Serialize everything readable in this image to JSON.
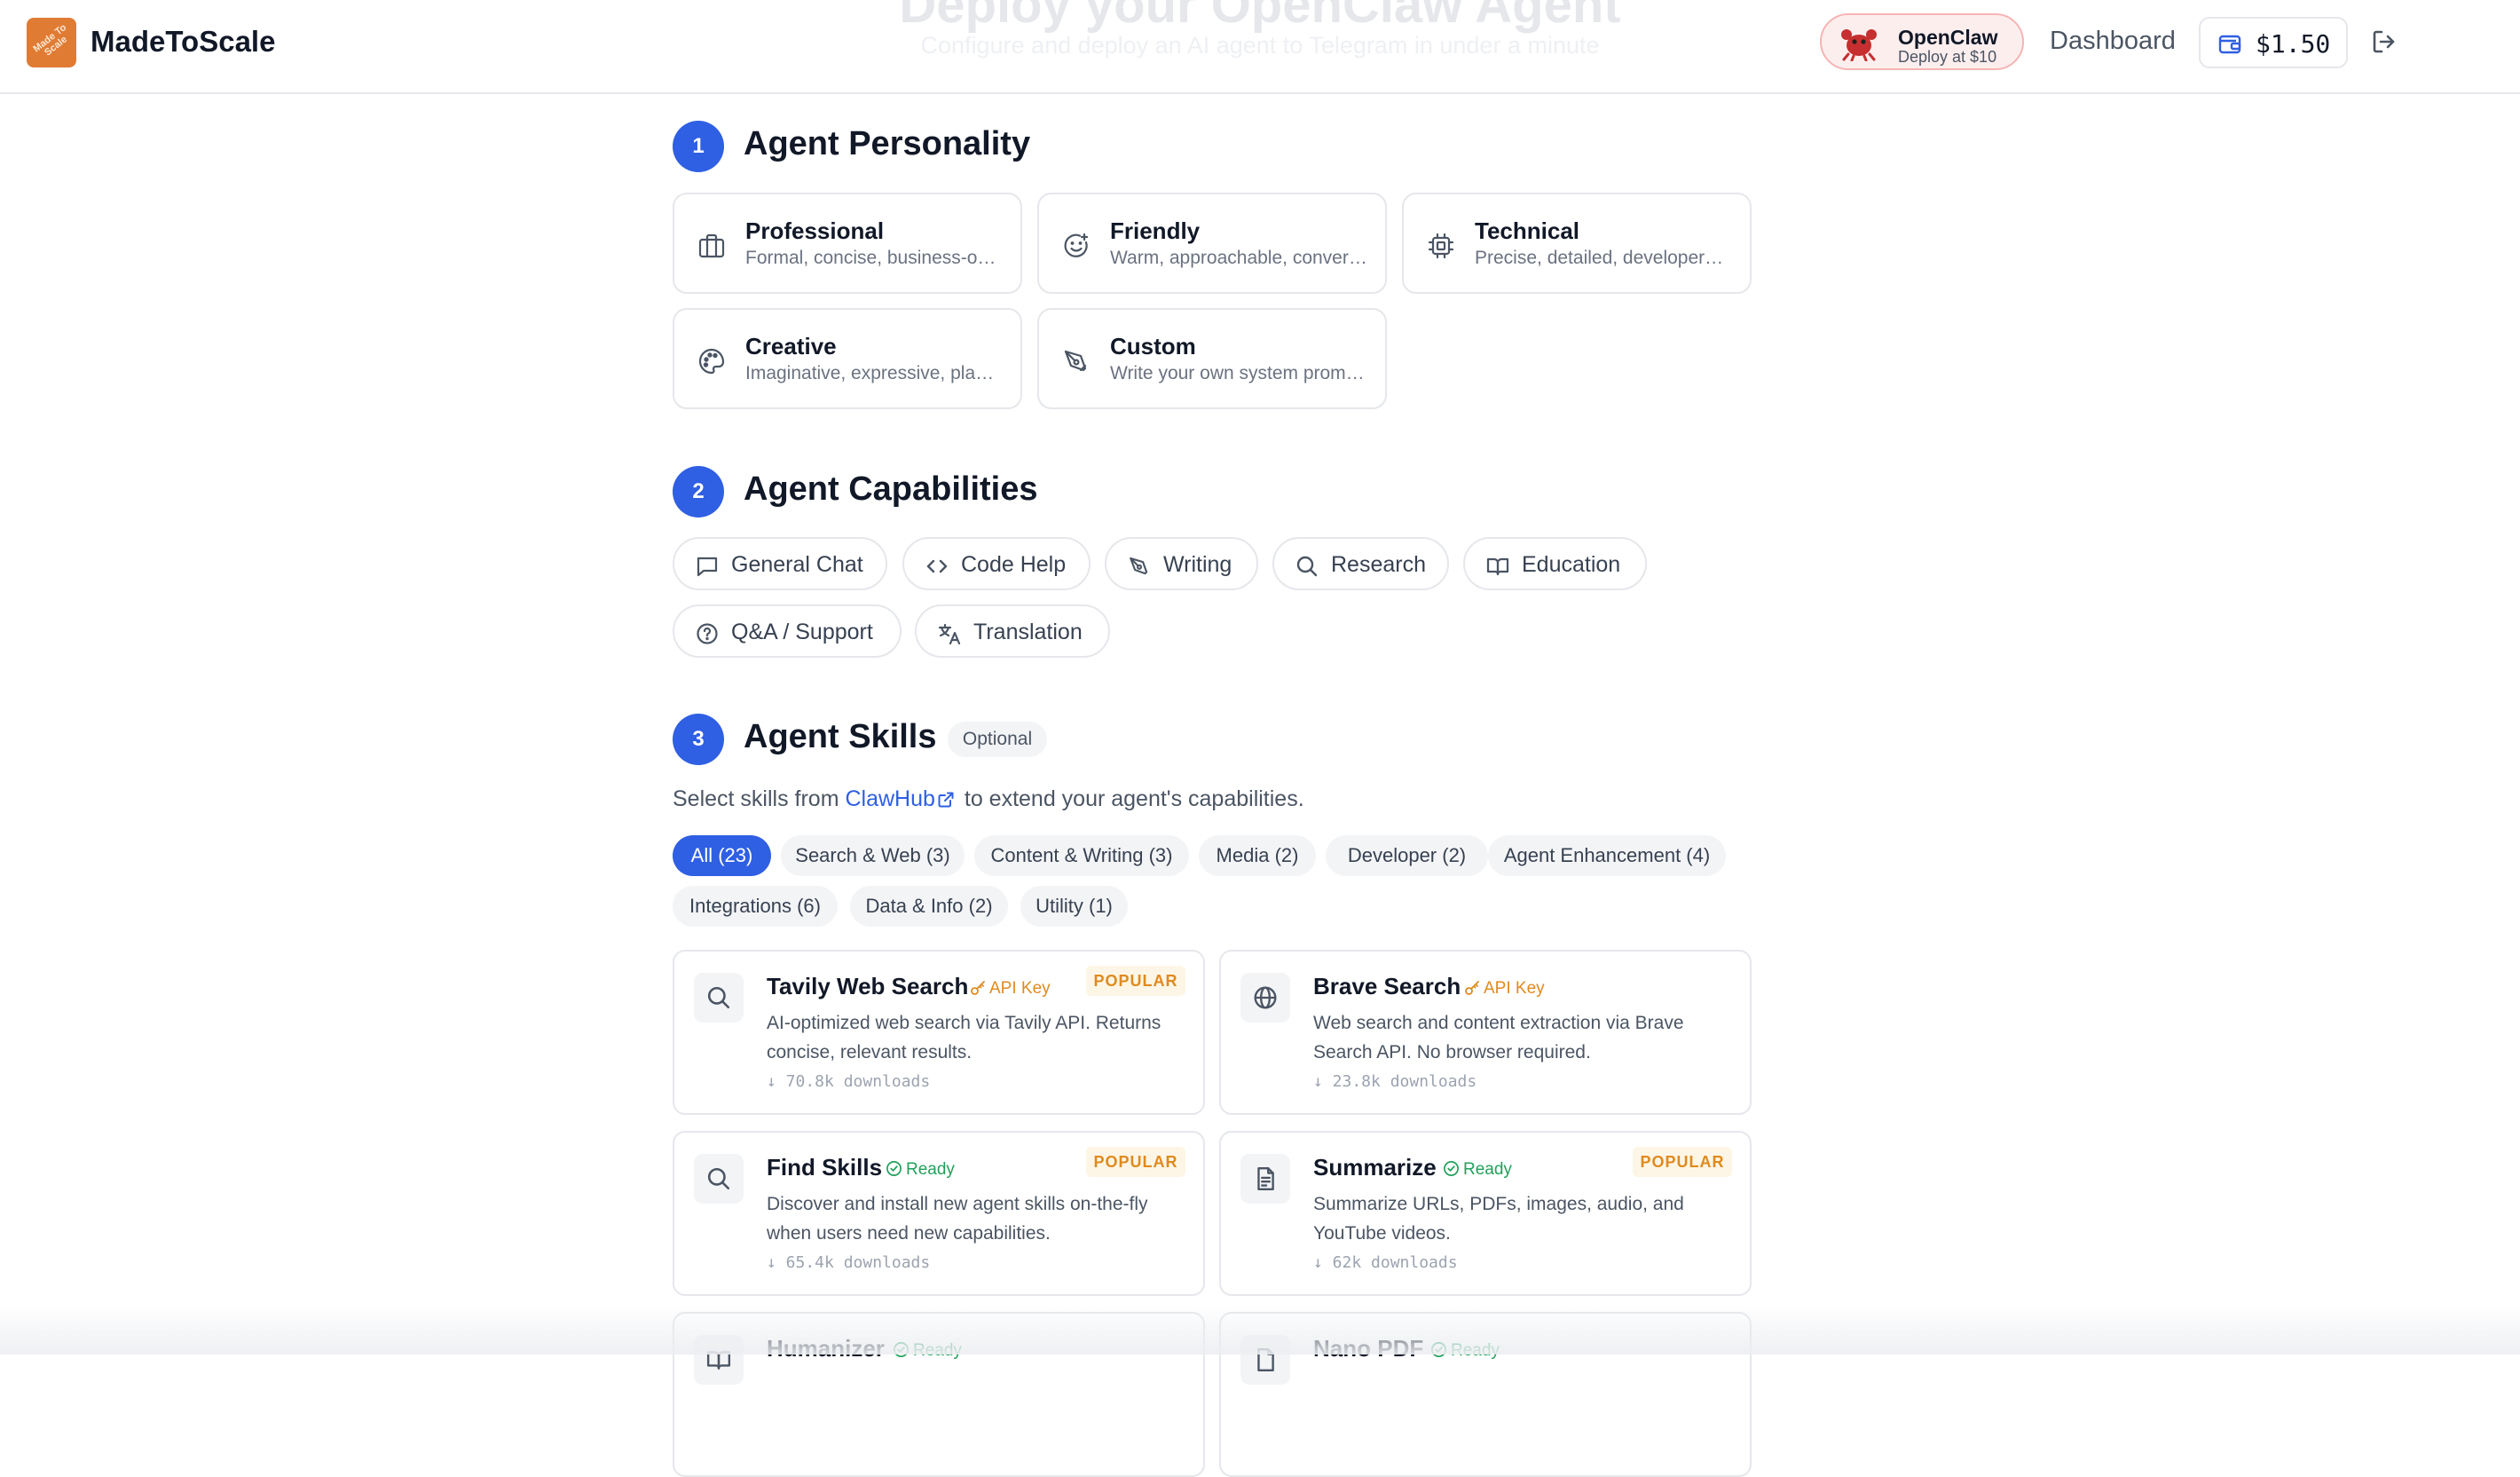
{
  "header": {
    "ghost_title": "Deploy your OpenClaw Agent",
    "ghost_subtitle": "Configure and deploy an AI agent to Telegram in under a minute",
    "brand": "MadeToScale",
    "logo_text": "Made To Scale",
    "openclaw_title": "OpenClaw",
    "openclaw_sub": "Deploy at $10",
    "dashboard": "Dashboard",
    "balance": "$1.50"
  },
  "personality": {
    "number": "1",
    "title": "Agent Personality",
    "cards": [
      {
        "title": "Professional",
        "desc": "Formal, concise, business-o…",
        "icon": "briefcase-icon"
      },
      {
        "title": "Friendly",
        "desc": "Warm, approachable, conver…",
        "icon": "smile-icon"
      },
      {
        "title": "Technical",
        "desc": "Precise, detailed, developer…",
        "icon": "cpu-icon"
      },
      {
        "title": "Creative",
        "desc": "Imaginative, expressive, pla…",
        "icon": "palette-icon"
      },
      {
        "title": "Custom",
        "desc": "Write your own system prom…",
        "icon": "pen-tool-icon"
      }
    ]
  },
  "capabilities": {
    "number": "2",
    "title": "Agent Capabilities",
    "items": [
      {
        "label": "General Chat",
        "icon": "message-square-icon"
      },
      {
        "label": "Code Help",
        "icon": "code-icon"
      },
      {
        "label": "Writing",
        "icon": "pen-tool-icon"
      },
      {
        "label": "Research",
        "icon": "search-icon"
      },
      {
        "label": "Education",
        "icon": "book-open-icon"
      },
      {
        "label": "Q&A / Support",
        "icon": "help-circle-icon"
      },
      {
        "label": "Translation",
        "icon": "languages-icon"
      }
    ]
  },
  "skills": {
    "number": "3",
    "title": "Agent Skills",
    "optional": "Optional",
    "intro_before": "Select skills from ",
    "intro_link": "ClawHub",
    "intro_after": " to extend your agent's capabilities.",
    "filters": [
      "All (23)",
      "Search & Web (3)",
      "Content & Writing (3)",
      "Media (2)",
      "Developer (2)",
      "Agent Enhancement (4)",
      "Integrations (6)",
      "Data & Info (2)",
      "Utility (1)"
    ],
    "active_filter": 0,
    "cards": [
      {
        "name": "Tavily Web Search",
        "status": "API Key",
        "popular": "POPULAR",
        "desc": "AI-optimized web search via Tavily API. Returns concise, relevant results.",
        "downloads": "↓ 70.8k downloads",
        "icon": "search-icon"
      },
      {
        "name": "Brave Search",
        "status": "API Key",
        "popular": "",
        "desc": "Web search and content extraction via Brave Search API. No browser required.",
        "downloads": "↓ 23.8k downloads",
        "icon": "globe-icon"
      },
      {
        "name": "Find Skills",
        "status": "Ready",
        "popular": "POPULAR",
        "desc": "Discover and install new agent skills on-the-fly when users need new capabilities.",
        "downloads": "↓ 65.4k downloads",
        "icon": "search-icon"
      },
      {
        "name": "Summarize",
        "status": "Ready",
        "popular": "POPULAR",
        "desc": "Summarize URLs, PDFs, images, audio, and YouTube videos.",
        "downloads": "↓ 62k downloads",
        "icon": "file-text-icon"
      },
      {
        "name": "Humanizer",
        "status": "Ready",
        "popular": "",
        "desc": "",
        "downloads": "",
        "icon": "book-icon"
      },
      {
        "name": "Nano PDF",
        "status": "Ready",
        "popular": "",
        "desc": "",
        "downloads": "",
        "icon": "file-icon"
      }
    ]
  },
  "colors": {
    "accent": "#2f5fe3",
    "api_key": "#e08a1e",
    "ready": "#22a05b",
    "logo": "#e07b34"
  }
}
